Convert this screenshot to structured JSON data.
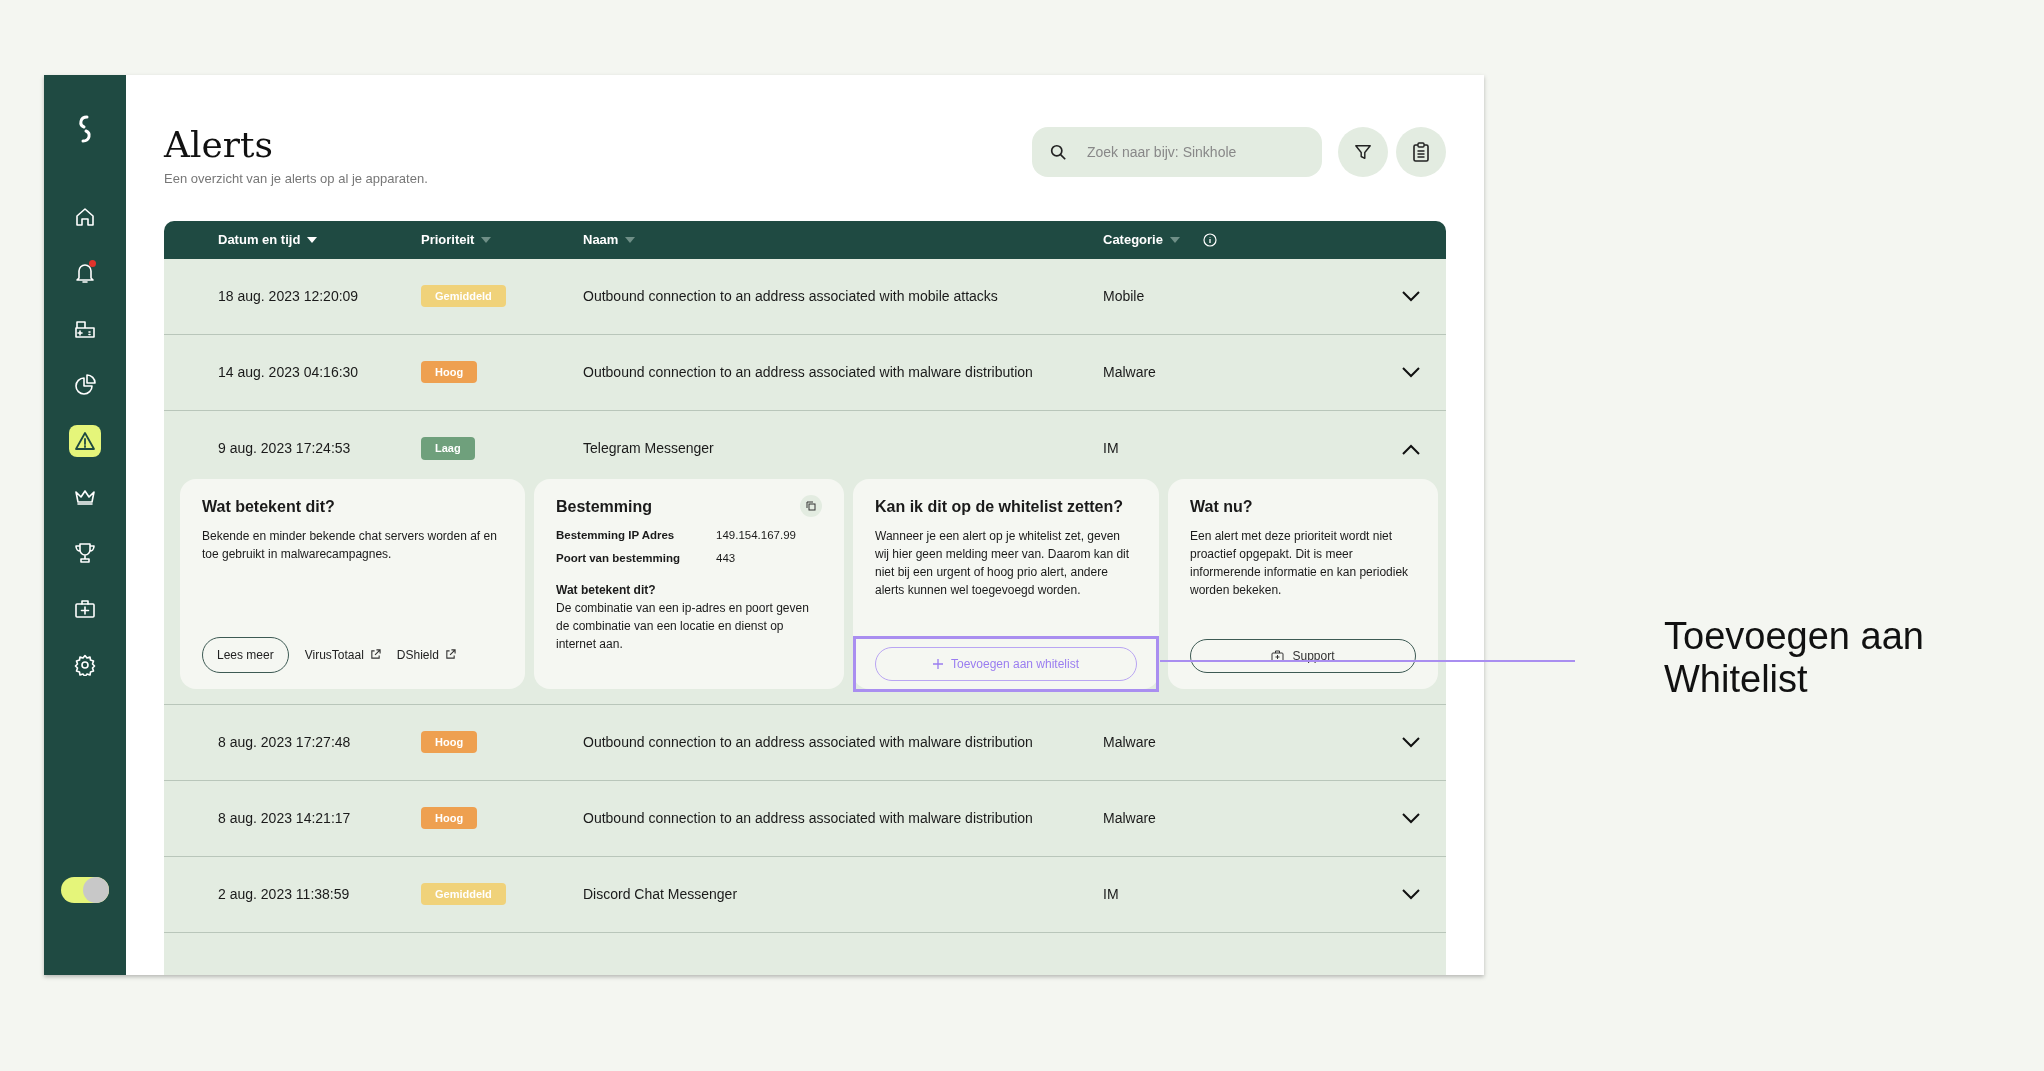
{
  "sidebar": {
    "items": [
      {
        "kind": "logo",
        "selected": false,
        "alert_dot": false
      },
      {
        "kind": "home",
        "selected": false,
        "alert_dot": false
      },
      {
        "kind": "bell",
        "selected": false,
        "alert_dot": true
      },
      {
        "kind": "router",
        "selected": false,
        "alert_dot": false
      },
      {
        "kind": "pie",
        "selected": false,
        "alert_dot": false
      },
      {
        "kind": "warning",
        "selected": true,
        "alert_dot": false
      },
      {
        "kind": "crown",
        "selected": false,
        "alert_dot": false
      },
      {
        "kind": "trophy",
        "selected": false,
        "alert_dot": false
      },
      {
        "kind": "medkit",
        "selected": false,
        "alert_dot": false
      },
      {
        "kind": "gear",
        "selected": false,
        "alert_dot": false
      }
    ],
    "toggle": {
      "on": true
    }
  },
  "header": {
    "title": "Alerts",
    "subtitle": "Een overzicht van je alerts op al je apparaten.",
    "search": {
      "placeholder": "Zoek naar bijv: Sinkhole"
    }
  },
  "table": {
    "columns": [
      {
        "label": "Datum en tijd",
        "sorted": true,
        "info": false
      },
      {
        "label": "Prioriteit",
        "sorted": false,
        "info": false
      },
      {
        "label": "Naam",
        "sorted": false,
        "info": false
      },
      {
        "label": "Categorie",
        "sorted": false,
        "info": true
      }
    ],
    "rows": [
      {
        "date": "18 aug. 2023 12:20:09",
        "priority": "Gemiddeld",
        "color": "#f0d27a",
        "name": "Outbound connection to an address associated with mobile attacks",
        "category": "Mobile",
        "expanded": false
      },
      {
        "date": "14 aug. 2023 04:16:30",
        "priority": "Hoog",
        "color": "#eea050",
        "name": "Outbound connection to an address associated with malware distribution",
        "category": "Malware",
        "expanded": false
      },
      {
        "date": "9 aug. 2023 17:24:53",
        "priority": "Laag",
        "color": "#6fa07c",
        "name": "Telegram Messenger",
        "category": "IM",
        "expanded": true,
        "details": [
          {
            "kind": "info",
            "title": "Wat betekent dit?",
            "text": "Bekende en minder bekende chat servers worden af en toe gebruikt in malwarecampagnes.",
            "actions": [
              {
                "kind": "button",
                "label": "Lees meer"
              },
              {
                "kind": "link",
                "label": "VirusTotaal"
              },
              {
                "kind": "link",
                "label": "DShield"
              }
            ]
          },
          {
            "kind": "destination",
            "title": "Bestemming",
            "fields": [
              {
                "label": "Bestemming IP Adres",
                "value": "149.154.167.99"
              },
              {
                "label": "Poort van bestemming",
                "value": "443"
              }
            ],
            "subheading": "Wat betekent dit?",
            "text": "De combinatie van een ip-adres en poort geven de combinatie van een locatie en dienst op internet aan."
          },
          {
            "kind": "whitelist",
            "title": "Kan ik dit op de whitelist zetten?",
            "text": "Wanneer je een alert op je whitelist zet, geven wij hier geen melding meer van. Daarom kan dit niet bij een urgent of hoog prio alert, andere alerts kunnen wel toegevoegd worden.",
            "actions": [
              {
                "kind": "add",
                "label": "Toevoegen aan whitelist"
              }
            ]
          },
          {
            "kind": "next",
            "title": "Wat nu?",
            "text": "Een alert met deze prioriteit wordt niet proactief opgepakt. Dit is meer informerende informatie en kan periodiek worden bekeken.",
            "actions": [
              {
                "kind": "support",
                "label": "Support"
              }
            ]
          }
        ]
      },
      {
        "date": "8 aug. 2023 17:27:48",
        "priority": "Hoog",
        "color": "#eea050",
        "name": "Outbound connection to an address associated with malware distribution",
        "category": "Malware",
        "expanded": false
      },
      {
        "date": "8 aug. 2023 14:21:17",
        "priority": "Hoog",
        "color": "#eea050",
        "name": "Outbound connection to an address associated with malware distribution",
        "category": "Malware",
        "expanded": false
      },
      {
        "date": "2 aug. 2023 11:38:59",
        "priority": "Gemiddeld",
        "color": "#f0d27a",
        "name": "Discord Chat Messenger",
        "category": "IM",
        "expanded": false
      }
    ]
  },
  "annotation": {
    "label": "Toevoegen aan Whitelist"
  }
}
